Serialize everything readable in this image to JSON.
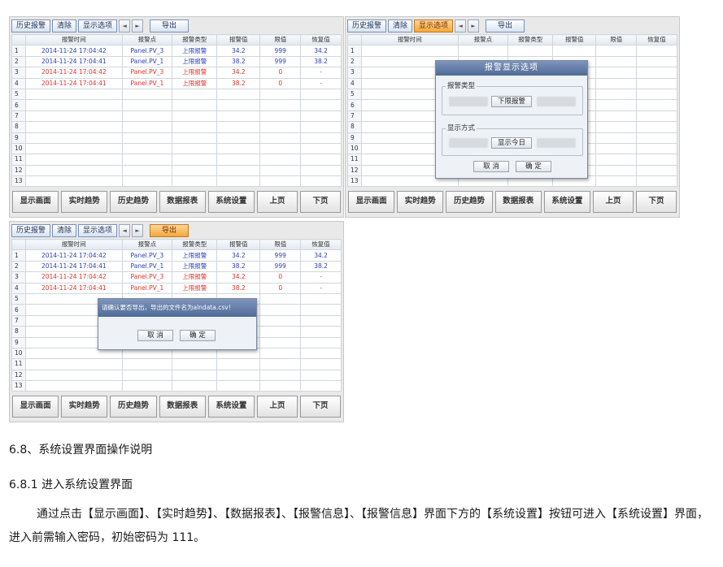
{
  "toolbar": {
    "history_label": "历史报警",
    "clear_label": "清除",
    "display_options_label": "显示选项",
    "prev_arrow": "◄",
    "next_arrow": "►",
    "export_label": "导出"
  },
  "table": {
    "headers": [
      "",
      "报警时间",
      "报警点",
      "报警类型",
      "报警值",
      "限值",
      "恢复值"
    ],
    "row_numbers": [
      "1",
      "2",
      "3",
      "4",
      "5",
      "6",
      "7",
      "8",
      "9",
      "10",
      "11",
      "12",
      "13"
    ],
    "rows": [
      {
        "time": "2014-11-24 17:04:42",
        "point": "Panel.PV_3",
        "type": "上限报警",
        "value": "34.2",
        "limit": "999",
        "recover": "34.2",
        "color": "#2b3fb5"
      },
      {
        "time": "2014-11-24 17:04:41",
        "point": "Panel.PV_1",
        "type": "上限报警",
        "value": "38.2",
        "limit": "999",
        "recover": "38.2",
        "color": "#2b3fb5"
      },
      {
        "time": "2014-11-24 17:04:42",
        "point": "Panel.PV_3",
        "type": "上限报警",
        "value": "34.2",
        "limit": "0",
        "recover": "-",
        "color": "#e0332b"
      },
      {
        "time": "2014-11-24 17:04:41",
        "point": "Panel.PV_1",
        "type": "上限报警",
        "value": "38.2",
        "limit": "0",
        "recover": "-",
        "color": "#e0332b"
      }
    ]
  },
  "nav": {
    "display_screen": "显示画面",
    "realtime_trend": "实时趋势",
    "history_trend": "历史趋势",
    "data_report": "数据报表",
    "system_settings": "系统设置",
    "prev_page": "上页",
    "next_page": "下页"
  },
  "options_dialog": {
    "title": "报警显示选项",
    "alarm_type_label": "报警类型",
    "lower_limit_option": "下限报警",
    "display_mode_label": "显示方式",
    "show_today_option": "显示今日",
    "cancel_label": "取 消",
    "ok_label": "确 定"
  },
  "export_dialog": {
    "message": "请确认要否导出，导出的文件名为alndata.csv！",
    "cancel_label": "取 消",
    "ok_label": "确 定"
  },
  "doc": {
    "heading_1": "6.8、系统设置界面操作说明",
    "heading_2": "6.8.1 进入系统设置界面",
    "body": "通过点击【显示画面】、【实时趋势】、【数据报表】、【报警信息】、【报警信息】界面下方的【系统设置】按钮可进入【系统设置】界面，进入前需输入密码，初始密码为 111。"
  },
  "colors": {
    "alarm_active": "#2b3fb5",
    "alarm_cleared": "#e0332b",
    "active_tab": "#f2a83a"
  }
}
